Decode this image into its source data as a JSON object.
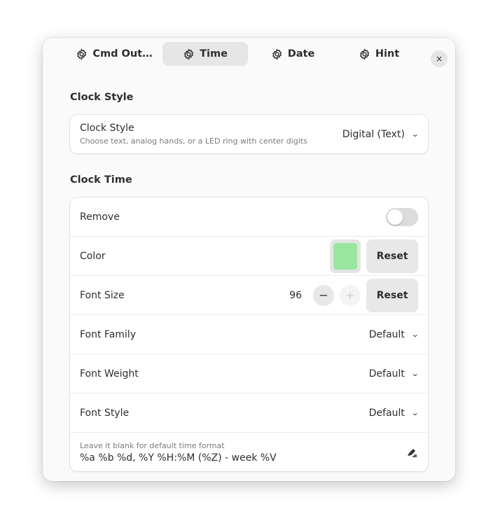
{
  "tabs": [
    {
      "label": "Cmd Out…",
      "icon": "gear-icon",
      "active": false
    },
    {
      "label": "Time",
      "icon": "gear-icon",
      "active": true
    },
    {
      "label": "Date",
      "icon": "gear-icon",
      "active": false
    },
    {
      "label": "Hint",
      "icon": "gear-icon",
      "active": false
    }
  ],
  "close_label": "×",
  "clock_style_section": {
    "title": "Clock Style",
    "row": {
      "label": "Clock Style",
      "subtitle": "Choose text, analog hands, or a LED ring with center digits",
      "value": "Digital (Text)"
    }
  },
  "clock_time_section": {
    "title": "Clock Time",
    "remove": {
      "label": "Remove",
      "enabled": false
    },
    "color": {
      "label": "Color",
      "swatch_color": "#99e6a0",
      "reset_label": "Reset"
    },
    "font_size": {
      "label": "Font Size",
      "value": "96",
      "minus": "−",
      "plus": "+",
      "reset_label": "Reset"
    },
    "font_family": {
      "label": "Font Family",
      "value": "Default"
    },
    "font_weight": {
      "label": "Font Weight",
      "value": "Default"
    },
    "font_style": {
      "label": "Font Style",
      "value": "Default"
    },
    "format": {
      "hint": "Leave it blank for default time format",
      "value": "%a %b %d, %Y %H:%M (%Z) - week %V"
    }
  },
  "chevron_glyph": "⌄"
}
